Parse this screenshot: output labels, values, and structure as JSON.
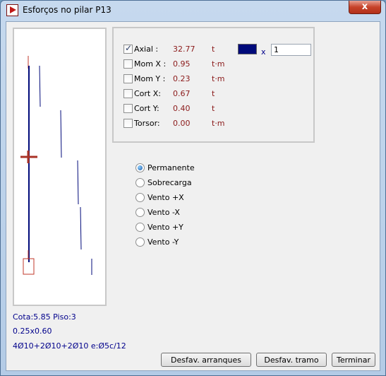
{
  "window": {
    "title": "Esforços no pilar P13",
    "close_label": "x"
  },
  "forces": [
    {
      "label": "Axial :",
      "value": "32.77",
      "unit": "t",
      "checked": true
    },
    {
      "label": "Mom X :",
      "value": "0.95",
      "unit": "t·m",
      "checked": false
    },
    {
      "label": "Mom Y :",
      "value": "0.23",
      "unit": "t·m",
      "checked": false
    },
    {
      "label": "Cort X:",
      "value": "0.67",
      "unit": "t",
      "checked": false
    },
    {
      "label": "Cort Y:",
      "value": "0.40",
      "unit": "t",
      "checked": false
    },
    {
      "label": "Torsor:",
      "value": "0.00",
      "unit": "t·m",
      "checked": false
    }
  ],
  "scale": {
    "color": "#000a7a",
    "x_label": "x",
    "value": "1"
  },
  "load_cases": {
    "options": [
      "Permanente",
      "Sobrecarga",
      "Vento +X",
      "Vento -X",
      "Vento +Y",
      "Vento -Y"
    ],
    "selected": "Permanente"
  },
  "status": {
    "line1": "Cota:5.85 Piso:3",
    "line2": "0.25x0.60",
    "line3": "4Ø10+2Ø10+2Ø10 e:Ø5c/12"
  },
  "buttons": {
    "desfav_arranques": "Desfav. arranques",
    "desfav_tramo": "Desfav. tramo",
    "terminar": "Terminar"
  }
}
